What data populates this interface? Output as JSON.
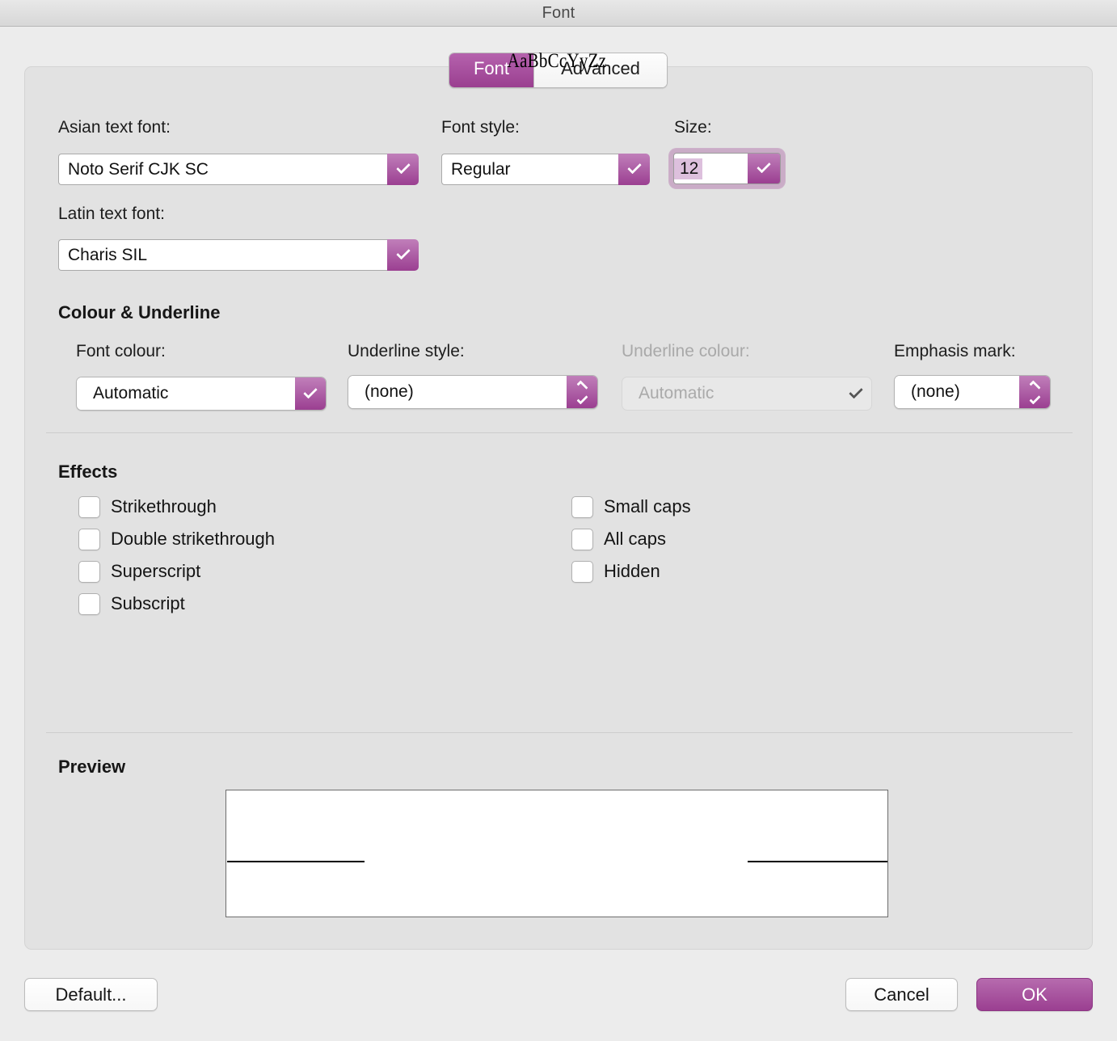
{
  "window": {
    "title": "Font"
  },
  "tabs": [
    {
      "id": "font",
      "label": "Font",
      "active": true
    },
    {
      "id": "advanced",
      "label": "Advanced",
      "active": false
    }
  ],
  "fields": {
    "asian_text_font": {
      "label": "Asian text font:",
      "value": "Noto Serif CJK SC"
    },
    "latin_text_font": {
      "label": "Latin text font:",
      "value": "Charis SIL"
    },
    "font_style": {
      "label": "Font style:",
      "value": "Regular"
    },
    "size": {
      "label": "Size:",
      "value": "12"
    }
  },
  "colour_underline": {
    "title": "Colour & Underline",
    "font_colour": {
      "label": "Font colour:",
      "value": "Automatic",
      "disabled": false
    },
    "underline_style": {
      "label": "Underline style:",
      "value": "(none)",
      "disabled": false
    },
    "underline_colour": {
      "label": "Underline colour:",
      "value": "Automatic",
      "disabled": true
    },
    "emphasis_mark": {
      "label": "Emphasis mark:",
      "value": "(none)",
      "disabled": false
    }
  },
  "effects": {
    "title": "Effects",
    "left_column": [
      {
        "label": "Strikethrough",
        "checked": false
      },
      {
        "label": "Double strikethrough",
        "checked": false
      },
      {
        "label": "Superscript",
        "checked": false
      },
      {
        "label": "Subscript",
        "checked": false
      }
    ],
    "right_column": [
      {
        "label": "Small caps",
        "checked": false
      },
      {
        "label": "All caps",
        "checked": false
      },
      {
        "label": "Hidden",
        "checked": false
      }
    ]
  },
  "preview": {
    "title": "Preview",
    "sample_text": "AaBbCcYyZz"
  },
  "buttons": {
    "default": "Default...",
    "cancel": "Cancel",
    "ok": "OK"
  },
  "icons": {
    "chevron_down": "chevron-down-icon",
    "stepper": "stepper-up-down-icon"
  },
  "colors": {
    "accent": "#9b3f91",
    "accent_light": "#c07fba",
    "window_bg": "#ececec",
    "panel_bg": "#e2e2e2",
    "selection": "#ddc0dd"
  }
}
